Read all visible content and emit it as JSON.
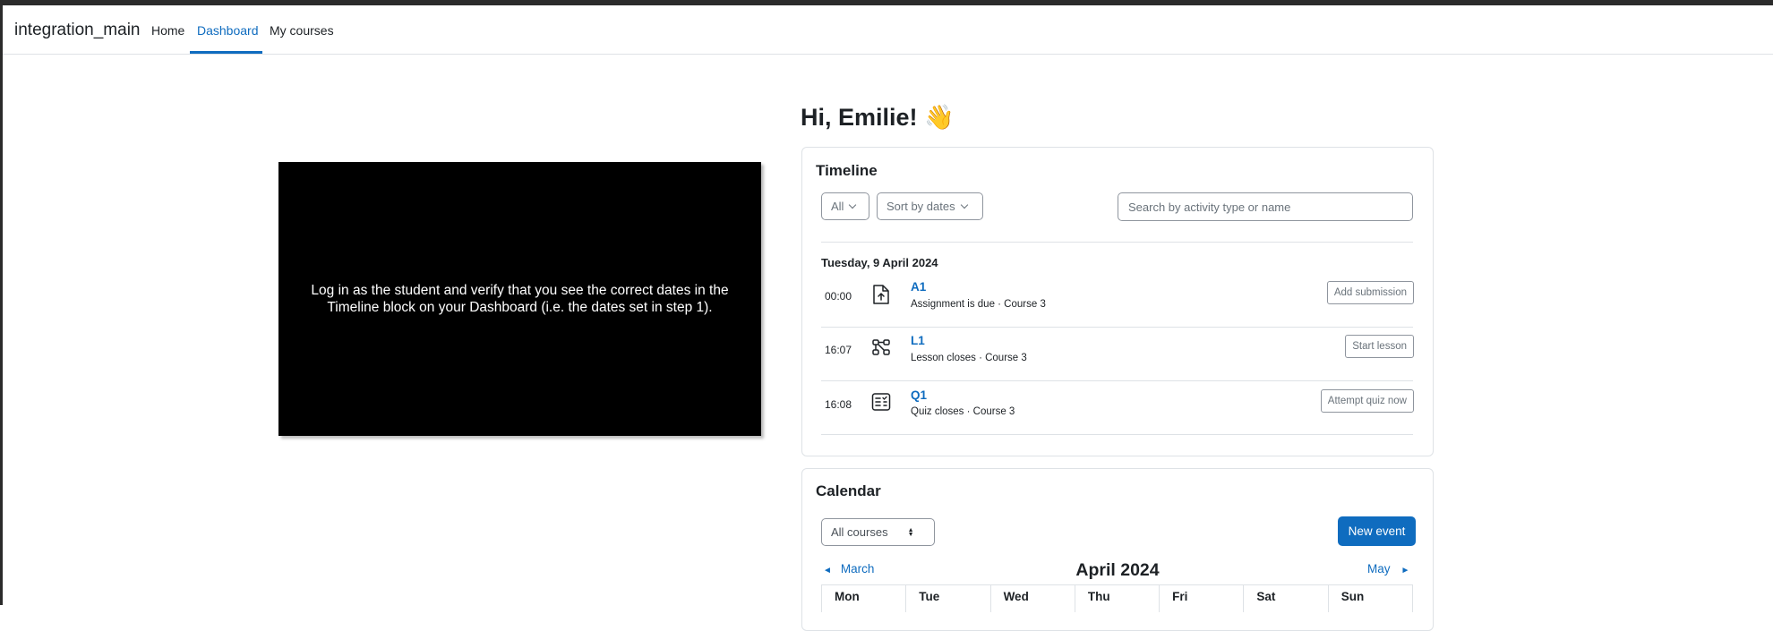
{
  "navbar": {
    "brand": "integration_main",
    "links": [
      "Home",
      "Dashboard",
      "My courses"
    ],
    "active": "Dashboard"
  },
  "instruction": "Log in as the student and verify that you see the correct dates in the Timeline block on your Dashboard (i.e. the dates set in step 1).",
  "greeting": "Hi, Emilie! 👋",
  "timeline": {
    "title": "Timeline",
    "filter_label": "All",
    "sort_label": "Sort by dates",
    "search_placeholder": "Search by activity type or name",
    "date_heading": "Tuesday, 9 April 2024",
    "events": [
      {
        "time": "00:00",
        "icon": "assignment-upload-icon",
        "name": "A1",
        "detail": "Assignment is due · Course 3",
        "action": "Add submission"
      },
      {
        "time": "16:07",
        "icon": "lesson-icon",
        "name": "L1",
        "detail": "Lesson closes · Course 3",
        "action": "Start lesson"
      },
      {
        "time": "16:08",
        "icon": "quiz-icon",
        "name": "Q1",
        "detail": "Quiz closes · Course 3",
        "action": "Attempt quiz now"
      }
    ]
  },
  "calendar": {
    "title": "Calendar",
    "course_filter": "All courses",
    "new_event_label": "New event",
    "prev_month": "March",
    "month": "April 2024",
    "next_month": "May",
    "weekdays": [
      "Mon",
      "Tue",
      "Wed",
      "Thu",
      "Fri",
      "Sat",
      "Sun"
    ]
  },
  "colors": {
    "accent": "#0f6cbf",
    "text": "#1d2125",
    "border": "#dee2e6"
  }
}
